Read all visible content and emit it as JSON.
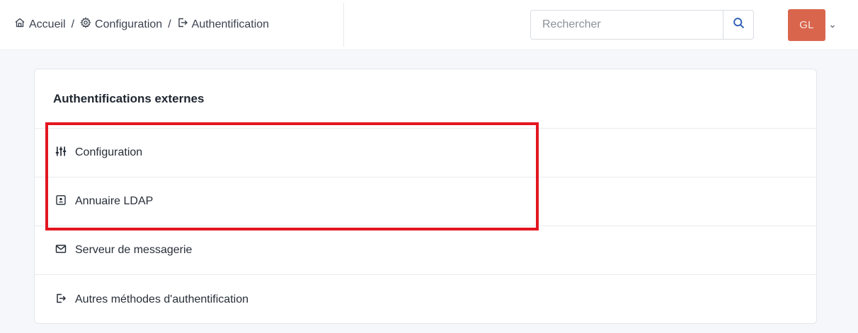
{
  "header": {
    "breadcrumb": [
      {
        "label": "Accueil",
        "icon": "home-icon"
      },
      {
        "label": "Configuration",
        "icon": "gear-icon"
      },
      {
        "label": "Authentification",
        "icon": "sign-in-icon"
      }
    ],
    "separator": "/",
    "search": {
      "placeholder": "Rechercher",
      "value": ""
    },
    "user": {
      "initials": "GL",
      "avatar_color": "#d9654d"
    }
  },
  "card": {
    "title": "Authentifications externes",
    "items": [
      {
        "label": "Configuration",
        "icon": "sliders-icon"
      },
      {
        "label": "Annuaire LDAP",
        "icon": "address-book-icon"
      },
      {
        "label": "Serveur de messagerie",
        "icon": "envelope-icon"
      },
      {
        "label": "Autres méthodes d'authentification",
        "icon": "sign-in-icon"
      }
    ]
  },
  "colors": {
    "highlight": "#e3161f",
    "accent": "#2f5fb3"
  }
}
